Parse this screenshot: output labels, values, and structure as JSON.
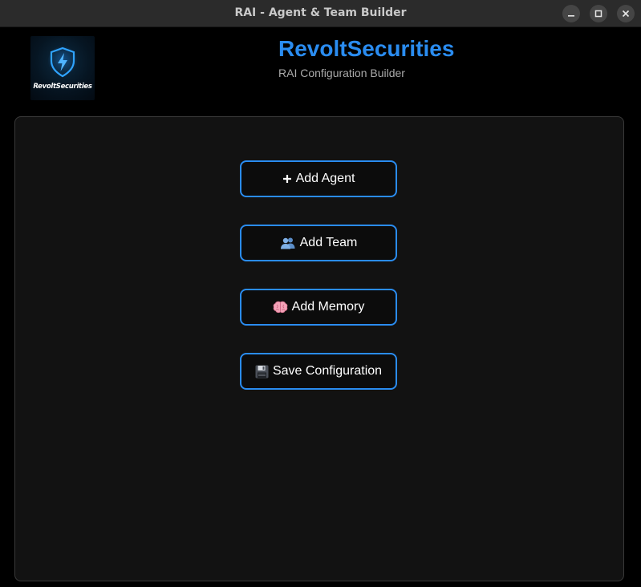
{
  "window": {
    "title": "RAI - Agent & Team Builder",
    "controls": [
      "minimize-icon",
      "maximize-icon",
      "close-icon"
    ]
  },
  "header": {
    "logo_text": "RevoltSecurities",
    "logo_icon": "shield-lightning-icon",
    "title": "RevoltSecurities",
    "subtitle": "RAI Configuration Builder"
  },
  "actions": {
    "add_agent": {
      "icon": "plus-icon",
      "label": "Add Agent"
    },
    "add_team": {
      "icon": "people-icon",
      "label": "Add Team"
    },
    "add_memory": {
      "icon": "brain-icon",
      "label": "Add Memory"
    },
    "save_config": {
      "icon": "floppy-disk-icon",
      "label": "Save Configuration"
    }
  },
  "colors": {
    "accent": "#2a8cf0",
    "panel_bg": "#121212",
    "window_bg": "#000000",
    "titlebar_bg": "#2b2b2b"
  }
}
